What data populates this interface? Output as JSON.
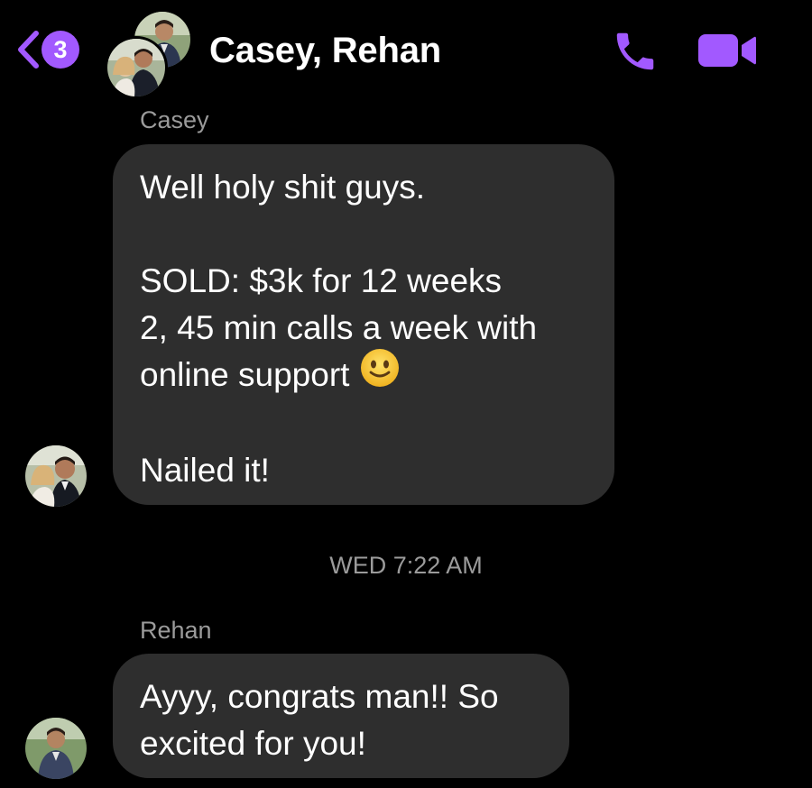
{
  "header": {
    "back_badge_count": "3",
    "title": "Casey, Rehan",
    "accent_color": "#a259ff",
    "icons": [
      "chevron-left-icon",
      "phone-icon",
      "video-camera-icon"
    ]
  },
  "messages": [
    {
      "sender": "Casey",
      "lines": [
        "Well holy shit guys.",
        "",
        "SOLD: $3k for 12 weeks",
        "2, 45 min calls a week with",
        "online support",
        "",
        "Nailed it!"
      ],
      "emoji": "slightly-smiling-face"
    },
    {
      "sender": "Rehan",
      "text": "Ayyy, congrats man!! So\nexcited for you!"
    }
  ],
  "timestamp": "WED 7:22 AM"
}
